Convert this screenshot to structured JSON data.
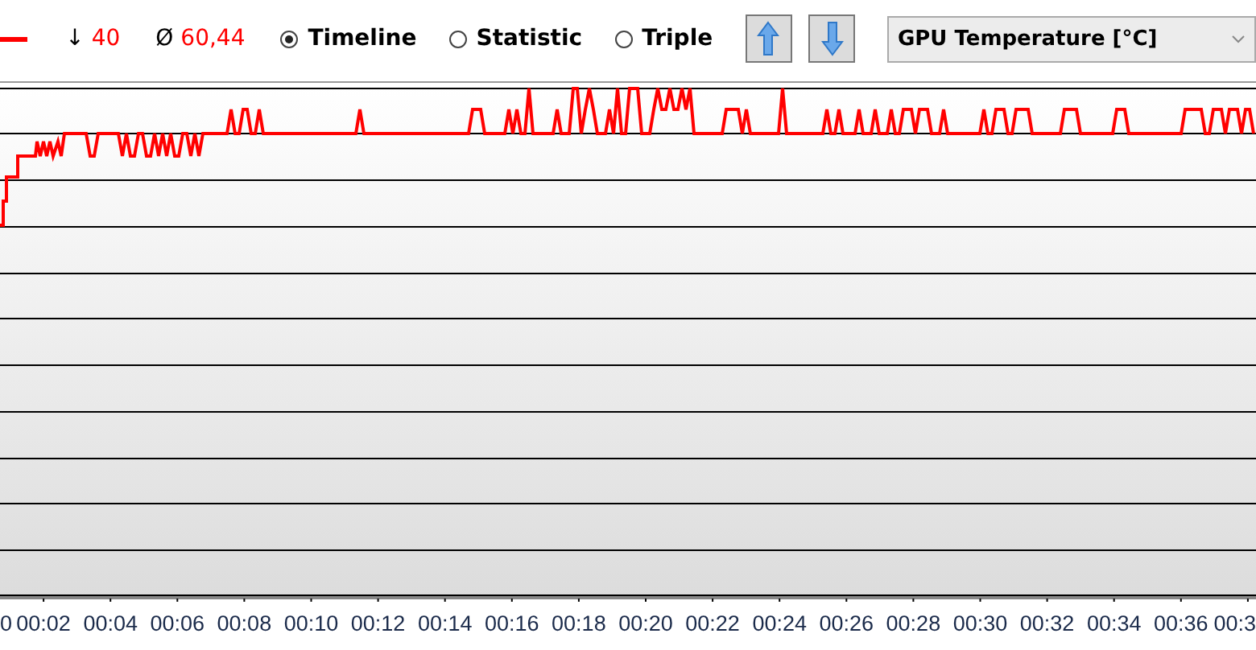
{
  "stats": [
    {
      "symbol": "↓",
      "value": "40"
    },
    {
      "symbol": "Ø",
      "value": "60,44"
    }
  ],
  "views": [
    {
      "label": "Timeline",
      "selected": true
    },
    {
      "label": "Statistic",
      "selected": false
    },
    {
      "label": "Triple",
      "selected": false
    }
  ],
  "sensor_select": {
    "value": "GPU Temperature [°C]"
  },
  "x_axis": {
    "tick_labels": [
      "0",
      "00:02",
      "00:04",
      "00:06",
      "00:08",
      "00:10",
      "00:12",
      "00:14",
      "00:16",
      "00:18",
      "00:20",
      "00:22",
      "00:24",
      "00:26",
      "00:28",
      "00:30",
      "00:32",
      "00:34",
      "00:36",
      "00:3"
    ]
  }
}
